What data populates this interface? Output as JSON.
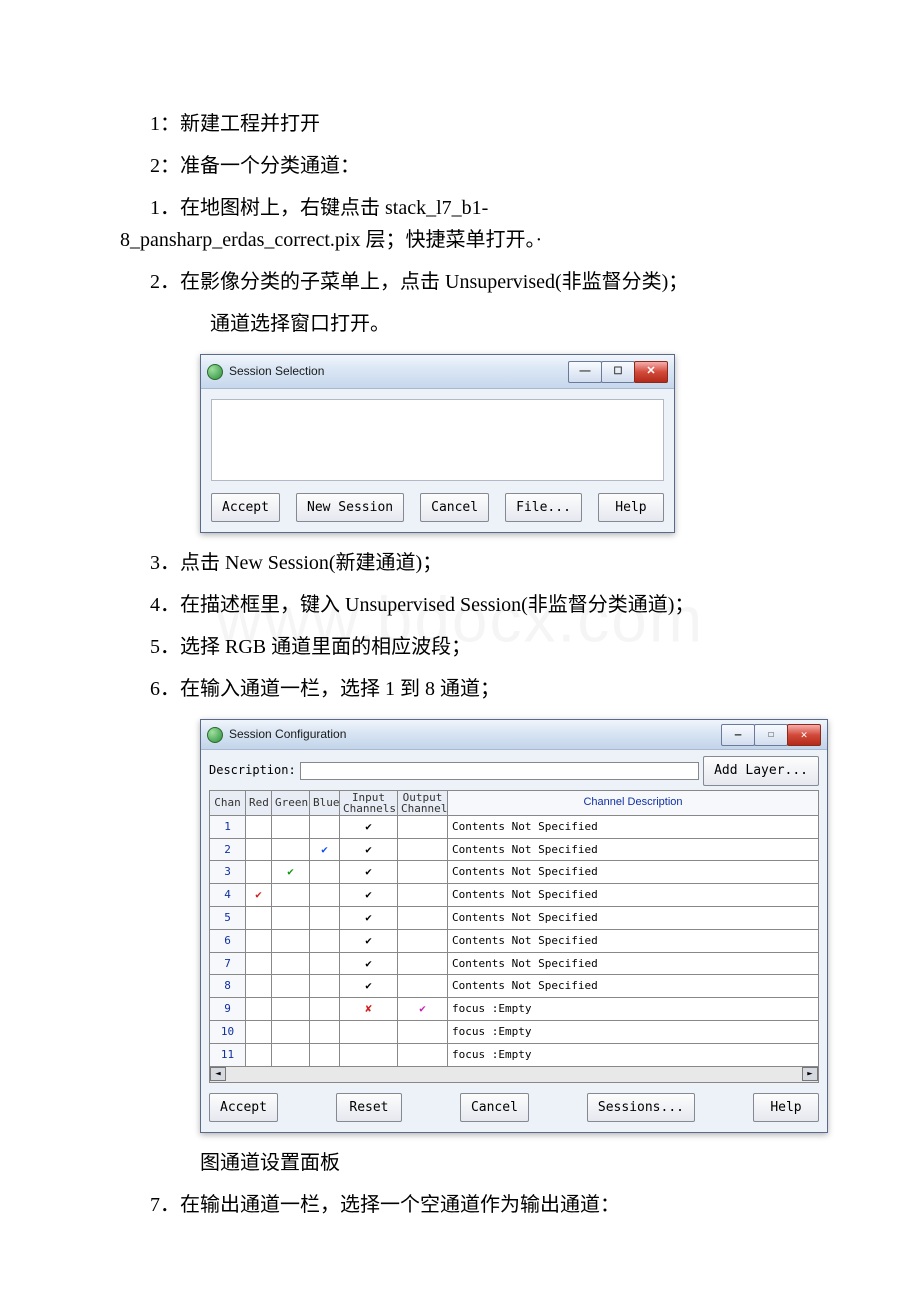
{
  "watermark": "www.bdocx.com",
  "lines": {
    "l1": "1：新建工程并打开",
    "l2": "2：准备一个分类通道：",
    "l3a": "1．在地图树上，右键点击 stack_l7_b1-",
    "l3b": "8_pansharp_erdas_correct.pix 层；快捷菜单打开。·",
    "l4": "2．在影像分类的子菜单上，点击 Unsupervised(非监督分类)；",
    "l5": "通道选择窗口打开。",
    "l6": "3．点击 New Session(新建通道)；",
    "l7": "4．在描述框里，键入 Unsupervised Session(非监督分类通道)；",
    "l8": "5．选择 RGB 通道里面的相应波段；",
    "l9": "6．在输入通道一栏，选择 1 到 8 通道；",
    "l10": "7．在输出通道一栏，选择一个空通道作为输出通道：",
    "caption2": "图通道设置面板"
  },
  "win1": {
    "title": "Session Selection",
    "buttons": {
      "accept": "Accept",
      "new_session": "New Session",
      "cancel": "Cancel",
      "file": "File...",
      "help": "Help"
    }
  },
  "win2": {
    "title": "Session Configuration",
    "desc_label": "Description:",
    "desc_value": "",
    "add_layer": "Add Layer...",
    "headers": {
      "chan": "Chan",
      "red": "Red",
      "green": "Green",
      "blue": "Blue",
      "input": "Input\nChannels",
      "output": "Output\nChannel",
      "desc": "Channel Description"
    },
    "rows": [
      {
        "chan": "1",
        "red": "",
        "green": "",
        "blue": "",
        "input": "check",
        "output": "",
        "desc": "Contents Not Specified"
      },
      {
        "chan": "2",
        "red": "",
        "green": "",
        "blue": "check-blue",
        "input": "check",
        "output": "",
        "desc": "Contents Not Specified"
      },
      {
        "chan": "3",
        "red": "",
        "green": "check-green",
        "blue": "",
        "input": "check",
        "output": "",
        "desc": "Contents Not Specified"
      },
      {
        "chan": "4",
        "red": "check-red",
        "green": "",
        "blue": "",
        "input": "check",
        "output": "",
        "desc": "Contents Not Specified"
      },
      {
        "chan": "5",
        "red": "",
        "green": "",
        "blue": "",
        "input": "check",
        "output": "",
        "desc": "Contents Not Specified"
      },
      {
        "chan": "6",
        "red": "",
        "green": "",
        "blue": "",
        "input": "check",
        "output": "",
        "desc": "Contents Not Specified"
      },
      {
        "chan": "7",
        "red": "",
        "green": "",
        "blue": "",
        "input": "check",
        "output": "",
        "desc": "Contents Not Specified"
      },
      {
        "chan": "8",
        "red": "",
        "green": "",
        "blue": "",
        "input": "check",
        "output": "",
        "desc": "Contents Not Specified"
      },
      {
        "chan": "9",
        "red": "",
        "green": "",
        "blue": "",
        "input": "x-red",
        "output": "check-magenta",
        "desc": "focus  :Empty"
      },
      {
        "chan": "10",
        "red": "",
        "green": "",
        "blue": "",
        "input": "",
        "output": "",
        "desc": "focus  :Empty"
      },
      {
        "chan": "11",
        "red": "",
        "green": "",
        "blue": "",
        "input": "",
        "output": "",
        "desc": "focus  :Empty"
      }
    ],
    "buttons": {
      "accept": "Accept",
      "reset": "Reset",
      "cancel": "Cancel",
      "sessions": "Sessions...",
      "help": "Help"
    }
  }
}
